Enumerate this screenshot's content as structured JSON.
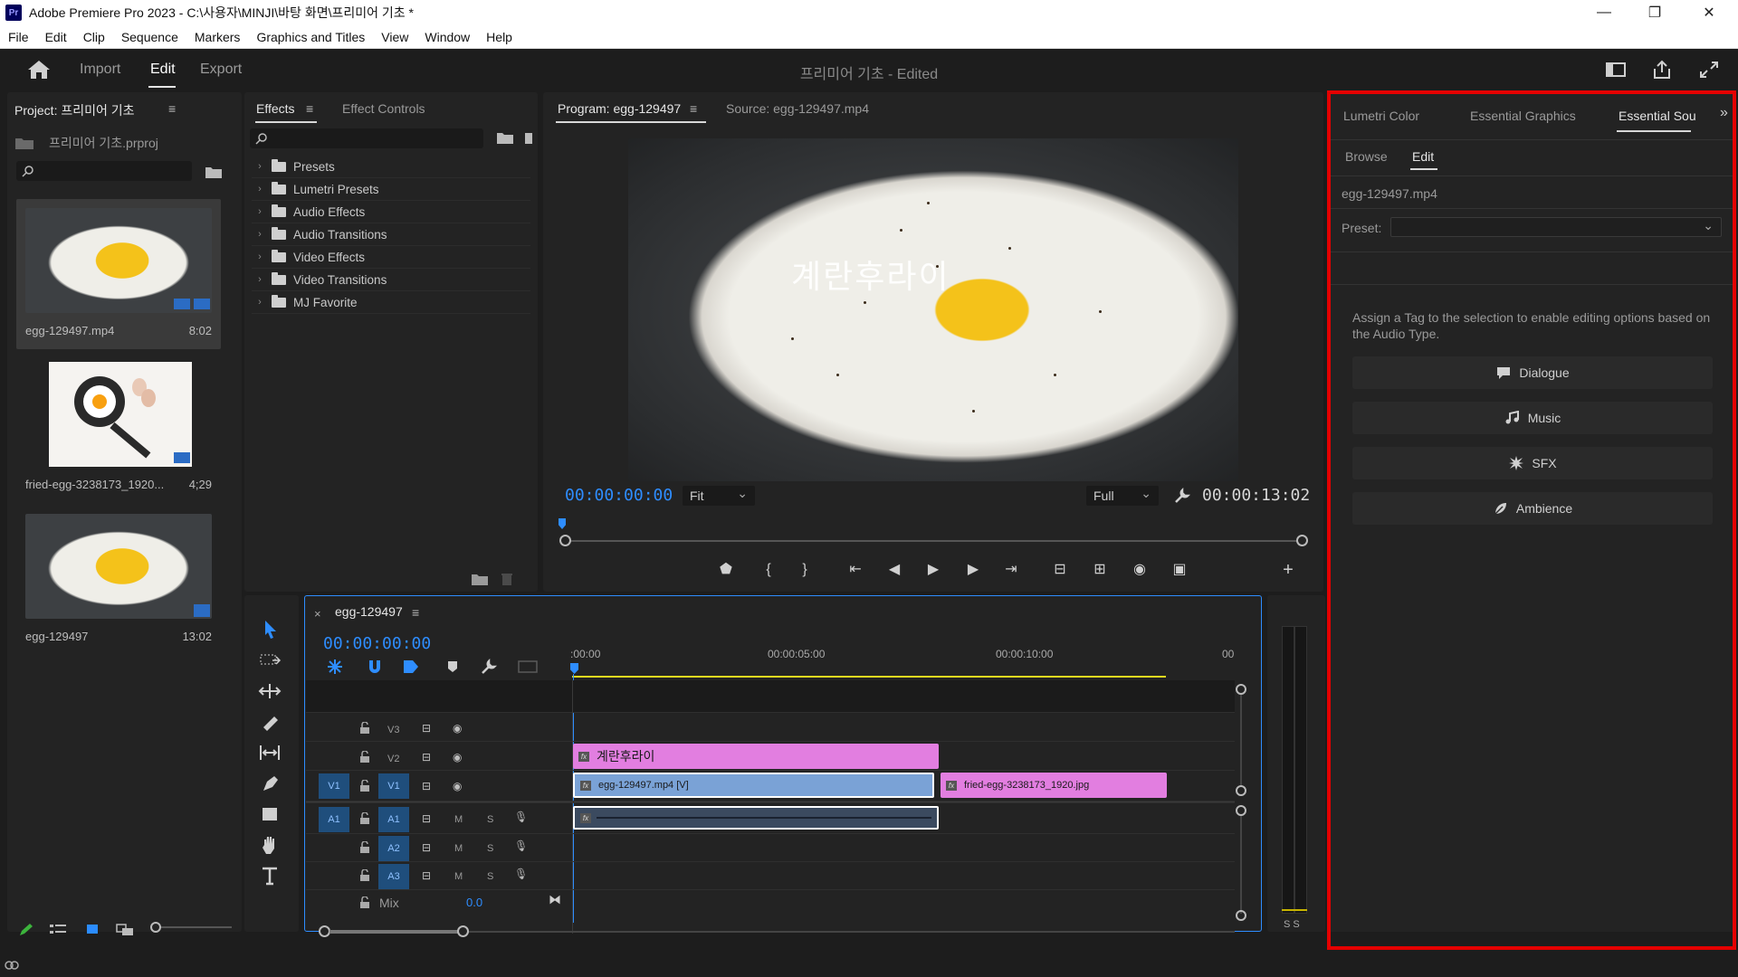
{
  "window": {
    "logo": "Pr",
    "title": "Adobe Premiere Pro 2023 - C:\\사용자\\MINJI\\바탕 화면\\프리미어 기초 *",
    "controls": {
      "minimize": "—",
      "restore": "❐",
      "close": "✕"
    }
  },
  "menu": [
    "File",
    "Edit",
    "Clip",
    "Sequence",
    "Markers",
    "Graphics and Titles",
    "View",
    "Window",
    "Help"
  ],
  "header": {
    "tabs": [
      "Import",
      "Edit",
      "Export"
    ],
    "active_tab": "Edit",
    "project_title": "프리미어 기초 - Edited",
    "icons": [
      "home-icon",
      "workspace-icon",
      "share-icon",
      "fullscreen-icon"
    ]
  },
  "project_panel": {
    "tab": "Project: 프리미어 기초",
    "menu_glyph": "≡",
    "file": "프리미어 기초.prproj",
    "items": [
      {
        "name": "egg-129497.mp4",
        "duration": "8:02"
      },
      {
        "name": "fried-egg-3238173_1920...",
        "duration": "4;29"
      },
      {
        "name": "egg-129497",
        "duration": "13:02"
      }
    ]
  },
  "effects_panel": {
    "tabs": [
      "Effects",
      "Effect Controls"
    ],
    "active_tab": "Effects",
    "menu_glyph": "≡",
    "items": [
      "Presets",
      "Lumetri Presets",
      "Audio Effects",
      "Audio Transitions",
      "Video Effects",
      "Video Transitions",
      "MJ Favorite"
    ]
  },
  "program_monitor": {
    "tabs": [
      "Program: egg-129497",
      "Source: egg-129497.mp4"
    ],
    "active_tab": "Program: egg-129497",
    "menu_glyph": "≡",
    "overlay_text": "계란후라이",
    "timecode_current": "00:00:00:00",
    "fit": "Fit",
    "quality": "Full",
    "timecode_duration": "00:00:13:02"
  },
  "timeline": {
    "sequence": "egg-129497",
    "close": "×",
    "menu_glyph": "≡",
    "timecode": "00:00:00:00",
    "ruler": [
      ":00:00",
      "00:00:05:00",
      "00:00:10:00",
      "00"
    ],
    "tracks": {
      "v3": "V3",
      "v2": "V2",
      "v1": "V1",
      "v1_src": "V1",
      "a1": "A1",
      "a1_src": "A1",
      "a2": "A2",
      "a3": "A3",
      "m": "M",
      "s": "S",
      "mix": "Mix",
      "mix_value": "0.0"
    },
    "clips": {
      "title": "계란후라이",
      "video1": "egg-129497.mp4 [V]",
      "video2": "fried-egg-3238173_1920.jpg",
      "fx": "fx"
    }
  },
  "audio_meter": {
    "labels": "S S"
  },
  "essential_sound": {
    "tabs": [
      "Lumetri Color",
      "Essential Graphics",
      "Essential Sou"
    ],
    "active_tab": "Essential Sou",
    "more": "»",
    "subtabs": [
      "Browse",
      "Edit"
    ],
    "active_subtab": "Edit",
    "clip": "egg-129497.mp4",
    "preset_label": "Preset:",
    "hint": "Assign a Tag to the selection to enable editing options based on the Audio Type.",
    "buttons": [
      {
        "label": "Dialogue",
        "icon": "dialogue-icon"
      },
      {
        "label": "Music",
        "icon": "music-icon"
      },
      {
        "label": "SFX",
        "icon": "sfx-icon"
      },
      {
        "label": "Ambience",
        "icon": "ambience-icon"
      }
    ]
  },
  "colors": {
    "highlight_border": "#e50000",
    "accent_blue": "#2e8dff",
    "clip_pink": "#e27ee0",
    "clip_blue": "#7aa2d6"
  }
}
